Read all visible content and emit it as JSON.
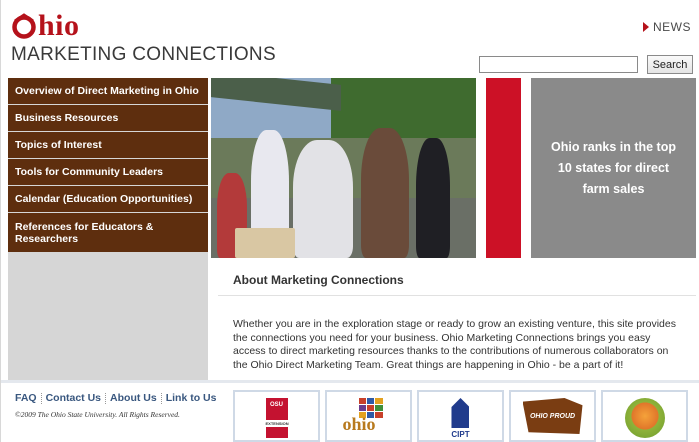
{
  "header": {
    "logo_word": "hio",
    "logo_subtitle": "MARKETING CONNECTIONS",
    "news_label": "NEWS",
    "search": {
      "value": "",
      "button_label": "Search"
    }
  },
  "sidebar": {
    "items": [
      {
        "label": "Overview of Direct Marketing in Ohio"
      },
      {
        "label": "Business Resources"
      },
      {
        "label": "Topics of Interest"
      },
      {
        "label": "Tools for Community Leaders"
      },
      {
        "label": "Calendar (Education Opportunities)"
      },
      {
        "label": "References for Educators & Researchers"
      }
    ]
  },
  "hero": {
    "callout": "Ohio ranks in the top 10 states for direct farm sales"
  },
  "about": {
    "title": "About Marketing Connections",
    "body": "Whether you are in the exploration stage or ready to grow an existing venture, this site provides the connections you need for your business. Ohio Marketing Connections brings you easy access to direct marketing resources thanks to the contributions of numerous collaborators on the Ohio Direct Marketing Team. Great things are happening in Ohio - be a part of it!"
  },
  "footer": {
    "links": [
      {
        "label": "FAQ"
      },
      {
        "label": "Contact Us"
      },
      {
        "label": "About Us"
      },
      {
        "label": "Link to Us"
      }
    ],
    "copyright": "©2009 The Ohio State University. All Rights Reserved."
  },
  "partner_logos": {
    "osu": {
      "line1": "OSU",
      "line2": "EXTENSION"
    },
    "our_ohio": {
      "word": "ohio"
    },
    "cipt": {
      "text": "CIPT"
    },
    "ohio_proud": {
      "text": "OHIO PROUD"
    }
  },
  "colors": {
    "brand_red": "#b5121b",
    "nav_brown": "#5e2e0e",
    "callout_gray": "#8a8a8a",
    "accent_red": "#cc1126",
    "link_blue": "#39577f"
  }
}
